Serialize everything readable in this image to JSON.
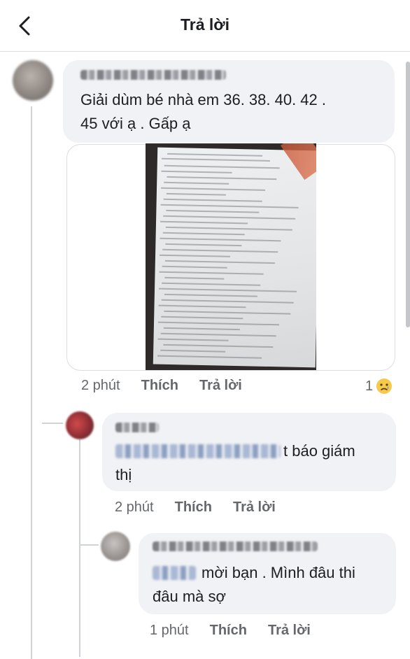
{
  "header": {
    "title": "Trả lời"
  },
  "comments": [
    {
      "text_line1": "Giải dùm bé nhà em 36. 38. 40. 42 .",
      "text_line2": "45 với ạ . Gấp ạ",
      "time": "2 phút",
      "like": "Thích",
      "reply": "Trả lời",
      "reaction_count": "1"
    },
    {
      "text_line1_suffix": "t báo giám",
      "text_line2": "thị",
      "time": "2 phút",
      "like": "Thích",
      "reply": "Trả lời"
    },
    {
      "text_line1_suffix": "mời bạn . Mình đâu thi",
      "text_line2": "đâu mà sợ",
      "time": "1 phút",
      "like": "Thích",
      "reply": "Trả lời"
    }
  ]
}
